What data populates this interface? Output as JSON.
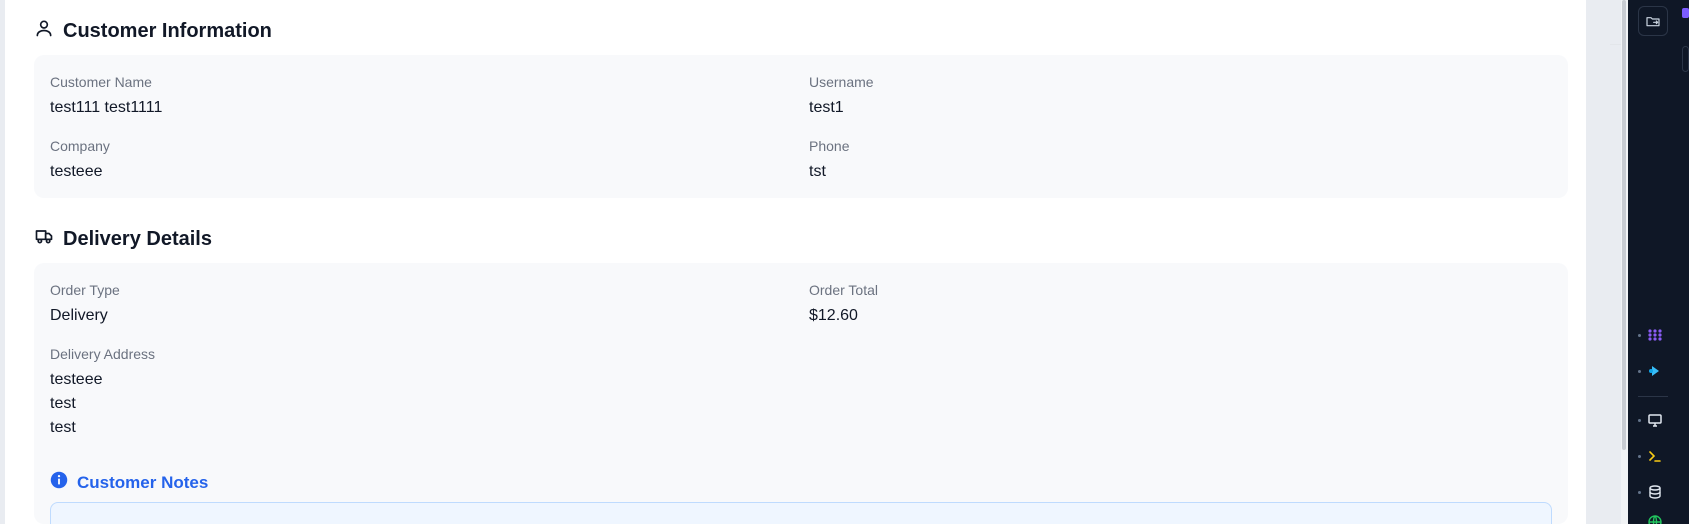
{
  "customer_info": {
    "title": "Customer Information",
    "fields": {
      "customer_name": {
        "label": "Customer Name",
        "value": "test111 test1111"
      },
      "username": {
        "label": "Username",
        "value": "test1"
      },
      "company": {
        "label": "Company",
        "value": "testeee"
      },
      "phone": {
        "label": "Phone",
        "value": "tst"
      }
    }
  },
  "delivery_details": {
    "title": "Delivery Details",
    "fields": {
      "order_type": {
        "label": "Order Type",
        "value": "Delivery"
      },
      "order_total": {
        "label": "Order Total",
        "value": "$12.60"
      },
      "delivery_address": {
        "label": "Delivery Address",
        "lines": [
          "testeee",
          "test",
          "test"
        ]
      }
    }
  },
  "customer_notes": {
    "title": "Customer Notes"
  },
  "colors": {
    "accent": "#2563eb",
    "card_bg": "#f8f9fb",
    "rail_bg": "#0f1726"
  },
  "icons": {
    "customer_section": "user-icon",
    "delivery_section": "truck-icon",
    "notes_section": "info-circle-icon",
    "rail": [
      "folder-arrow-icon",
      "grid-dots-icon",
      "play-nodes-icon",
      "monitor-icon",
      "terminal-icon",
      "database-icon",
      "globe-icon"
    ]
  }
}
